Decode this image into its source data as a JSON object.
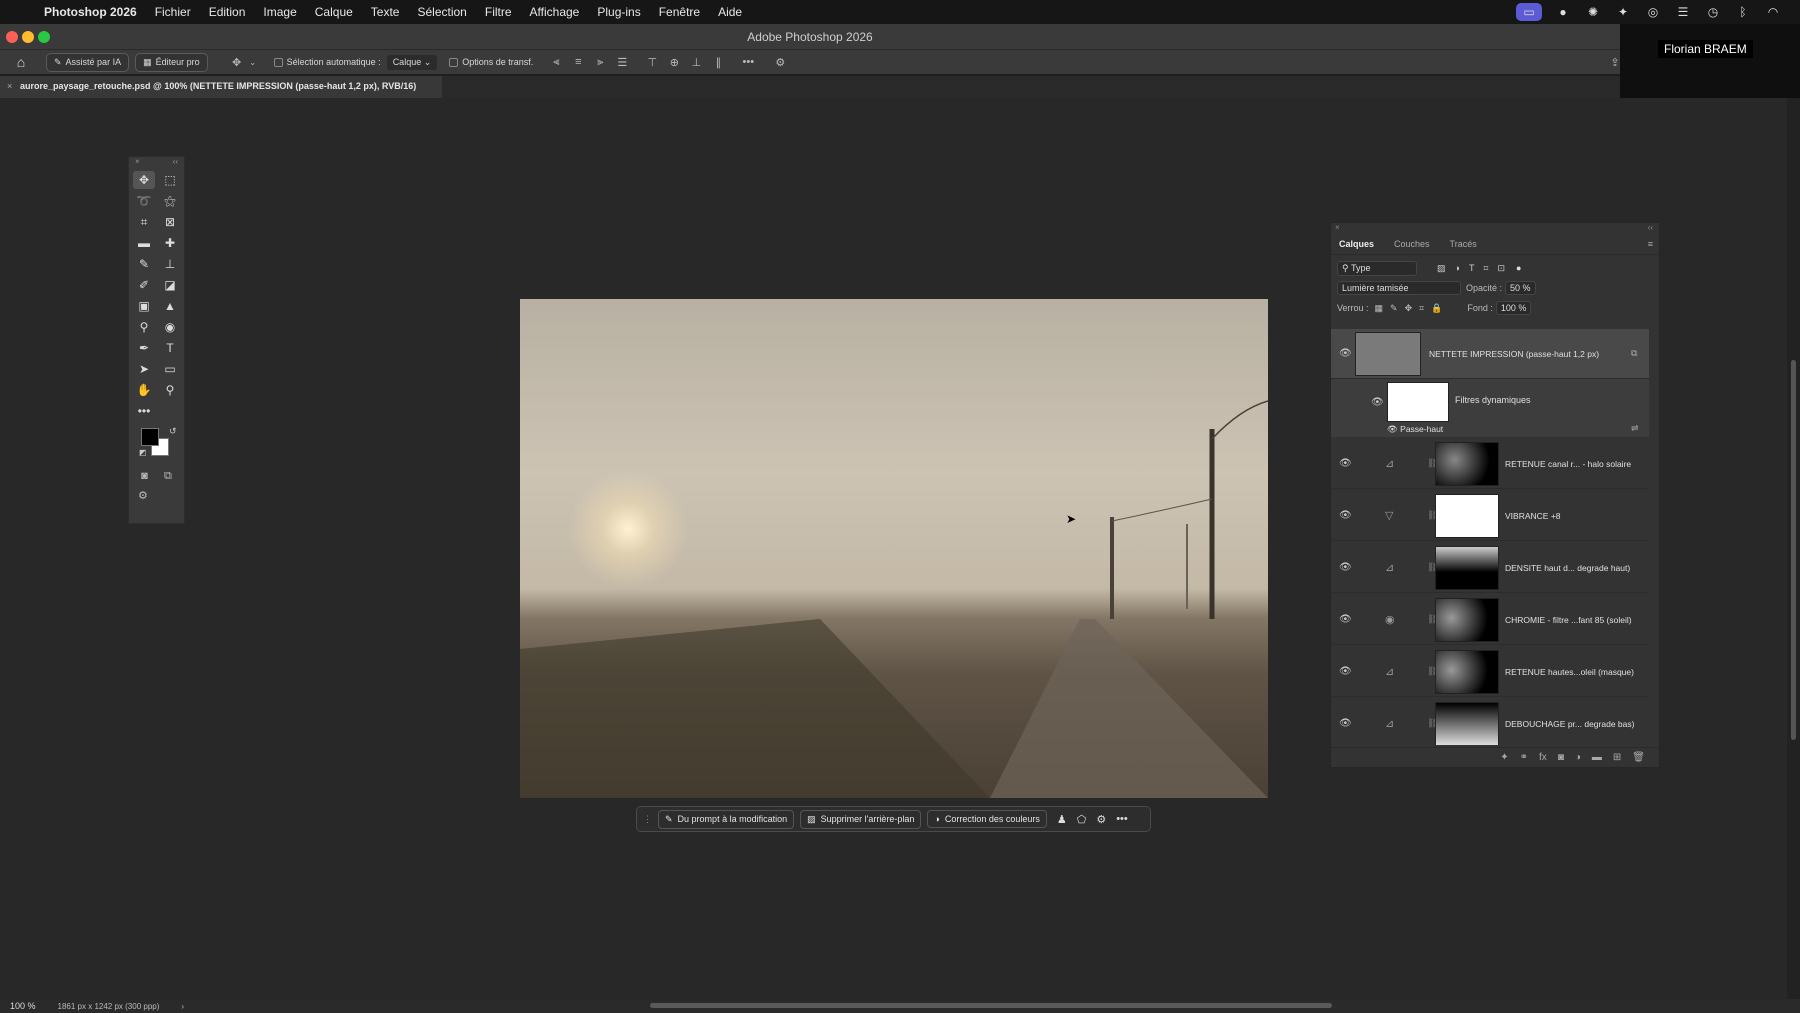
{
  "menubar": {
    "app": "Photoshop 2026",
    "items": [
      "Fichier",
      "Edition",
      "Image",
      "Calque",
      "Texte",
      "Sélection",
      "Filtre",
      "Affichage",
      "Plug-ins",
      "Fenêtre",
      "Aide"
    ],
    "status_icons": [
      "screen-mirror-icon",
      "messages-icon",
      "brightness-icon",
      "sparkle-icon",
      "creative-cloud-icon",
      "storage-icon",
      "clock-icon",
      "bluetooth-icon",
      "wifi-icon"
    ]
  },
  "window": {
    "title": "Adobe Photoshop 2026",
    "user": "Florian BRAEM"
  },
  "options": {
    "ai_assist": "Assisté par IA",
    "pro_editor": "Éditeur pro",
    "auto_select": "Sélection automatique :",
    "auto_select_value": "Calque",
    "transform_options": "Options de transf."
  },
  "document": {
    "tab_title": "aurore_paysage_retouche.psd @ 100% (NETTETE IMPRESSION (passe-haut 1,2 px), RVB/16)"
  },
  "contextbar": {
    "prompt": "Du prompt à la modification",
    "remove_bg": "Supprimer l'arrière-plan",
    "color_correction": "Correction des couleurs"
  },
  "layers_panel": {
    "tabs": [
      "Calques",
      "Couches",
      "Tracés"
    ],
    "filter_type": "Type",
    "blend_mode": "Lumière tamisée",
    "opacity_label": "Opacité :",
    "opacity_value": "50 %",
    "lock_label": "Verrou :",
    "fill_label": "Fond :",
    "fill_value": "100 %",
    "smart_filters": "Filtres dynamiques",
    "high_pass": "Passe-haut",
    "layers": [
      {
        "name": "NETTETE IMPRESSION (passe-haut 1,2 px)"
      },
      {
        "name": "RETENUE canal r... - halo solaire",
        "adj": "curves-icon"
      },
      {
        "name": "VIBRANCE +8",
        "adj": "vibrance-icon"
      },
      {
        "name": "DENSITE haut d... degrade haut)",
        "adj": "curves-icon"
      },
      {
        "name": "CHROMIE - filtre ...fant 85 (soleil)",
        "adj": "photo-filter-icon"
      },
      {
        "name": "RETENUE hautes...oleil (masque)",
        "adj": "curves-icon"
      },
      {
        "name": "DEBOUCHAGE pr... degrade bas)",
        "adj": "curves-icon"
      }
    ]
  },
  "status": {
    "zoom": "100 %",
    "doc_info": "1861 px x 1242 px (300 ppp)"
  }
}
